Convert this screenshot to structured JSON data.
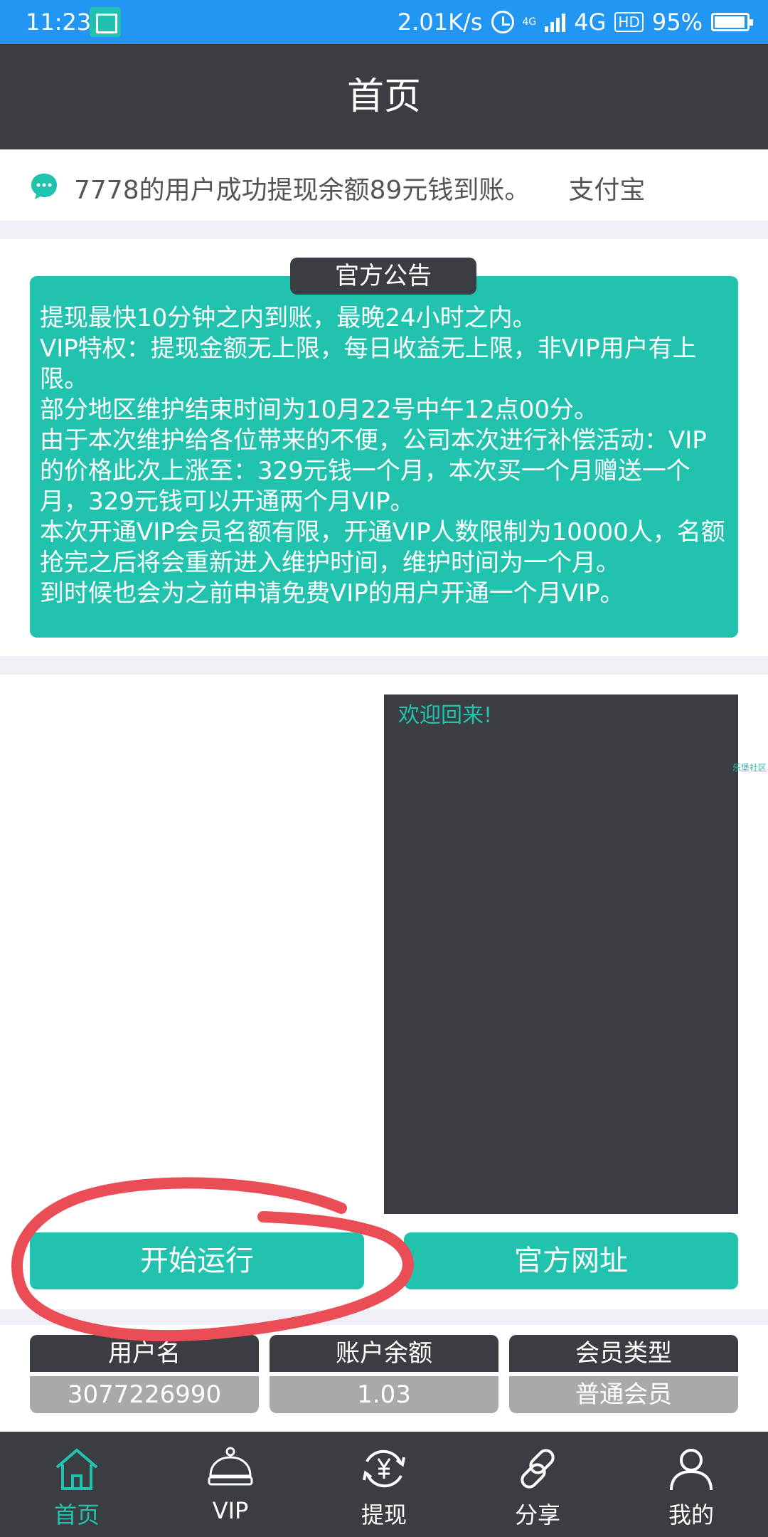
{
  "status_bar": {
    "time": "11:23",
    "network_speed": "2.01K/s",
    "small_4g": "4G",
    "network_type": "4G",
    "hd": "HD",
    "battery": "95%"
  },
  "header": {
    "title": "首页"
  },
  "marquee": {
    "text": "7778的用户成功提现余额89元钱到账。　　支付宝"
  },
  "notice": {
    "tab_label": "官方公告",
    "lines": [
      "提现最快10分钟之内到账，最晚24小时之内。",
      "VIP特权：提现金额无上限，每日收益无上限，非VIP用户有上限。",
      "部分地区维护结束时间为10月22号中午12点00分。",
      "由于本次维护给各位带来的不便，公司本次进行补偿活动：VIP的价格此次上涨至：329元钱一个月，本次买一个月赠送一个月，329元钱可以开通两个月VIP。",
      "本次开通VIP会员名额有限，开通VIP人数限制为10000人，名额抢完之后将会重新进入维护时间，维护时间为一个月。",
      "到时候也会为之前申请免费VIP的用户开通一个月VIP。"
    ]
  },
  "console": {
    "welcome": "欢迎回来!"
  },
  "side_tag": "乐堡社区",
  "buttons": {
    "start": "开始运行",
    "site": "官方网址"
  },
  "account": {
    "username_label": "用户名",
    "username_value": "3077226990",
    "balance_label": "账户余额",
    "balance_value": "1.03",
    "member_label": "会员类型",
    "member_value": "普通会员"
  },
  "tabbar": {
    "home": "首页",
    "vip": "VIP",
    "withdraw": "提现",
    "share": "分享",
    "mine": "我的"
  },
  "colors": {
    "accent": "#21c3af",
    "dark": "#3a3d42",
    "status": "#2196f3",
    "annotation": "#ea4d55"
  }
}
